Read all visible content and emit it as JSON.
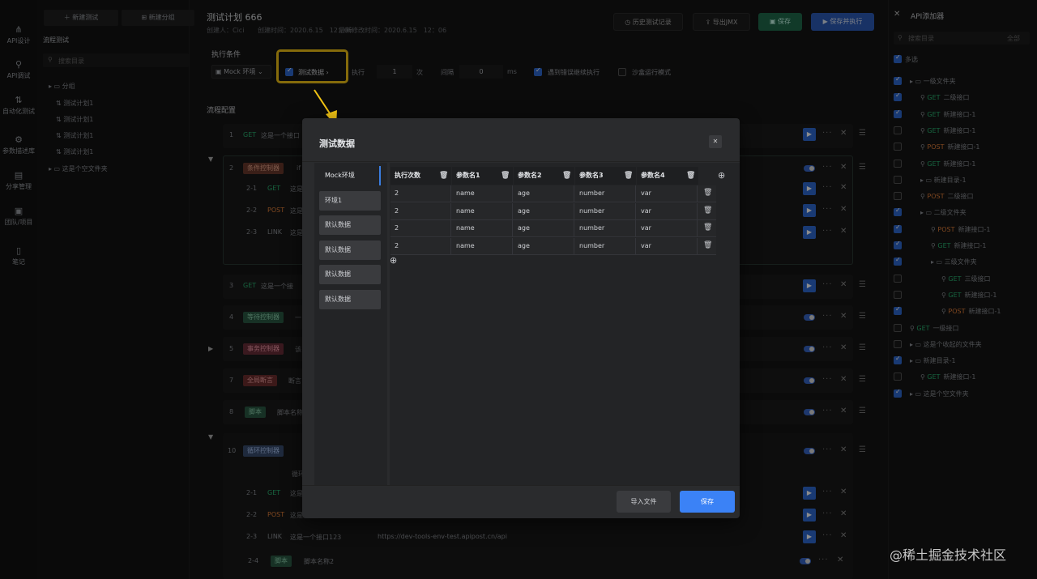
{
  "nav": [
    {
      "label": "API设计",
      "icon": "api-design-icon"
    },
    {
      "label": "API调试",
      "icon": "api-debug-icon"
    },
    {
      "label": "自动化测试",
      "icon": "automation-icon"
    },
    {
      "label": "参数描述库",
      "icon": "param-library-icon"
    },
    {
      "label": "分享管理",
      "icon": "share-icon"
    },
    {
      "label": "团队/项目",
      "icon": "team-icon"
    },
    {
      "label": "笔记",
      "icon": "notes-icon"
    }
  ],
  "panel1": {
    "new_test": "新建测试",
    "new_group": "新建分组",
    "section": "流程测试",
    "search_placeholder": "搜索目录",
    "tree": [
      "分组",
      "测试计划1",
      "测试计划1",
      "测试计划1",
      "测试计划1",
      "这是个空文件夹"
    ]
  },
  "header": {
    "title": "测试计划 666",
    "creator": "创建人：Cici",
    "created": "创建时间：2020.6.15　12：06",
    "modified": "最新修改时间：2020.6.15　12：06",
    "history": "历史测试记录",
    "export": "导出JMX",
    "save": "保存",
    "save_run": "保存并执行"
  },
  "conditions": {
    "title": "执行条件",
    "env": "Mock 环境",
    "test_data": "测试数据",
    "exec": "执行",
    "times_value": "1",
    "times_unit": "次",
    "interval": "间隔",
    "interval_value": "0",
    "interval_unit": "ms",
    "continue_on_error": "遇到错误继续执行",
    "sandbox": "沙盒运行模式"
  },
  "flow": {
    "title": "流程配置",
    "rows": [
      {
        "num": "1",
        "method": "GET",
        "text": "这是一个接口"
      },
      {
        "num": "2",
        "tag": "条件控制器",
        "text": "if"
      },
      {
        "num": "2-1",
        "method": "GET",
        "text": "这是"
      },
      {
        "num": "2-2",
        "method": "POST",
        "text": "这是"
      },
      {
        "num": "2-3",
        "method": "LINK",
        "text": "这是"
      },
      {
        "num": "3",
        "method": "GET",
        "text": "这是一个接"
      },
      {
        "num": "4",
        "tag": "等待控制器",
        "text": "一"
      },
      {
        "num": "5",
        "tag": "事务控制器",
        "text": "该"
      },
      {
        "num": "7",
        "tag": "全局断言",
        "text": "断言"
      },
      {
        "num": "8",
        "tag": "脚本",
        "text": "脚本名称"
      },
      {
        "num": "10",
        "tag": "循环控制器",
        "text": "循环"
      },
      {
        "num": "2-1",
        "method": "GET",
        "text": "这是"
      },
      {
        "num": "2-2",
        "method": "POST",
        "text": "这是"
      },
      {
        "num": "2-3",
        "method": "LINK",
        "text": "这是一个接口123",
        "url": "https://dev-tools-env-test.apipost.cn/api"
      },
      {
        "num": "2-4",
        "tag": "脚本",
        "text": "脚本名称2"
      }
    ]
  },
  "right": {
    "title": "API添加器",
    "search_placeholder": "搜索目录",
    "filter": "全部",
    "multi": "多选",
    "items": [
      {
        "text": "一级文件夹",
        "method": "",
        "checked": "partial",
        "indent": 0
      },
      {
        "text": "二级接口",
        "method": "GET",
        "checked": true,
        "indent": 1
      },
      {
        "text": "新建接口-1",
        "method": "GET",
        "checked": true,
        "indent": 1
      },
      {
        "text": "新建接口-1",
        "method": "GET",
        "checked": false,
        "indent": 1
      },
      {
        "text": "新建接口-1",
        "method": "POST",
        "checked": false,
        "indent": 1
      },
      {
        "text": "新建接口-1",
        "method": "GET",
        "checked": false,
        "indent": 1
      },
      {
        "text": "新建目录-1",
        "method": "",
        "checked": false,
        "indent": 1
      },
      {
        "text": "二级接口",
        "method": "POST",
        "checked": false,
        "indent": 1
      },
      {
        "text": "二级文件夹",
        "method": "",
        "checked": true,
        "indent": 1
      },
      {
        "text": "新建接口-1",
        "method": "POST",
        "checked": true,
        "indent": 2
      },
      {
        "text": "新建接口-1",
        "method": "GET",
        "checked": true,
        "indent": 2
      },
      {
        "text": "三级文件夹",
        "method": "",
        "checked": true,
        "indent": 2
      },
      {
        "text": "三级接口",
        "method": "GET",
        "checked": false,
        "indent": 3
      },
      {
        "text": "新建接口-1",
        "method": "GET",
        "checked": false,
        "indent": 3
      },
      {
        "text": "新建接口-1",
        "method": "POST",
        "checked": true,
        "indent": 3
      },
      {
        "text": "一级接口",
        "method": "GET",
        "checked": false,
        "indent": 0
      },
      {
        "text": "这是个收起的文件夹",
        "method": "",
        "checked": false,
        "indent": 0
      },
      {
        "text": "新建目录-1",
        "method": "",
        "checked": true,
        "indent": 0
      },
      {
        "text": "新建接口-1",
        "method": "GET",
        "checked": false,
        "indent": 1
      },
      {
        "text": "这是个空文件夹",
        "method": "",
        "checked": true,
        "indent": 0
      }
    ]
  },
  "modal": {
    "title": "测试数据",
    "envs": [
      "Mock环境",
      "环境1",
      "默认数据",
      "默认数据",
      "默认数据",
      "默认数据"
    ],
    "headers": [
      "执行次数",
      "参数名1",
      "参数名2",
      "参数名3",
      "参数名4"
    ],
    "rows": [
      [
        "2",
        "name",
        "age",
        "number",
        "var"
      ],
      [
        "2",
        "name",
        "age",
        "number",
        "var"
      ],
      [
        "2",
        "name",
        "age",
        "number",
        "var"
      ],
      [
        "2",
        "name",
        "age",
        "number",
        "var"
      ]
    ],
    "import": "导入文件",
    "save": "保存"
  },
  "watermark": "@稀土掘金技术社区",
  "colors": {
    "accent": "#2e6ad4",
    "highlight": "#f2c414",
    "get": "#2bb673",
    "post": "#e6813a",
    "save_green": "#1f7a53"
  }
}
